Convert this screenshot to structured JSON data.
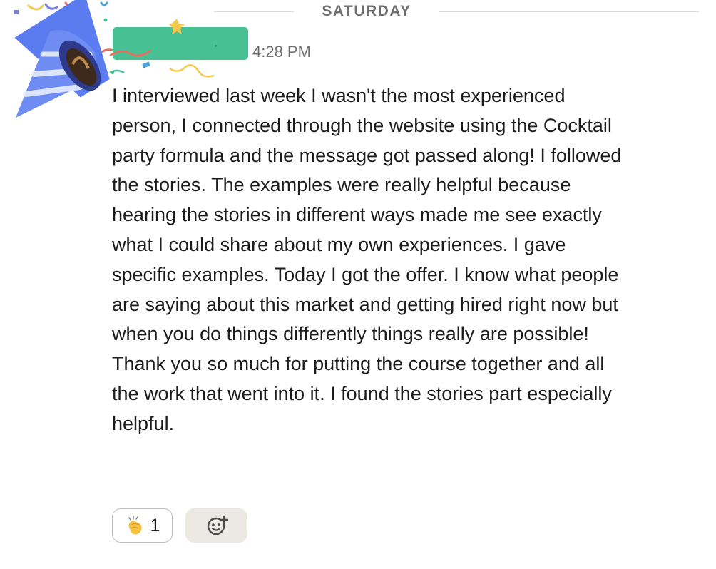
{
  "divider": {
    "day_label": "SATURDAY"
  },
  "message": {
    "sender_avatar_icon": "party-popper-icon",
    "timestamp": "4:28 PM",
    "text": "I interviewed last week I wasn't the most experienced person, I connected through the website using the Cocktail party formula and the message got passed along! I followed the stories. The examples were really helpful because hearing the stories in different ways made me see exactly what I could share about my own experiences. I gave specific examples. Today I got the offer. I know what people are saying about this market and getting hired right now but when you do things differently things really are possible! Thank you so much for putting the course together and all the work that went into it. I found the stories part especially helpful.",
    "reactions": [
      {
        "icon": "clapping-hands-icon",
        "count": "1"
      }
    ],
    "add_reaction_icon": "add-emoji-icon"
  },
  "colors": {
    "name_highlight": "#47c194",
    "text": "#1d1c1d",
    "muted": "#6f6f6f",
    "add_reaction_bg": "#ece8e4"
  }
}
